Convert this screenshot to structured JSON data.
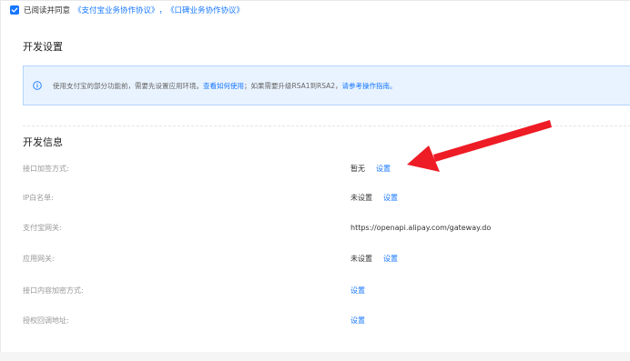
{
  "agreement": {
    "checked": true,
    "text": "已阅读并同意",
    "link_alipay": "《支付宝业务协作协议》",
    "separator": "，",
    "link_koubei": "《口碑业务协作协议》"
  },
  "dev_settings": {
    "title": "开发设置",
    "alert": {
      "text_before": "使用支付宝的部分功能前，需要先设置应用环境。",
      "link_how_to_use": "查看如何使用",
      "text_middle": "；如果需要升级RSA1到RSA2，",
      "link_guide": "请参考操作指南。"
    }
  },
  "dev_info": {
    "title": "开发信息",
    "rows": [
      {
        "label": "接口加签方式:",
        "status": "暂无",
        "action": "设置"
      },
      {
        "label": "IP白名单:",
        "status": "未设置",
        "action": "设置"
      },
      {
        "label": "支付宝网关:",
        "status": "https://openapi.alipay.com/gateway.do",
        "action": ""
      },
      {
        "label": "应用网关:",
        "status": "未设置",
        "action": "设置"
      },
      {
        "label": "接口内容加密方式:",
        "status": "",
        "action": "设置"
      },
      {
        "label": "授权回调地址:",
        "status": "",
        "action": "设置"
      }
    ]
  },
  "colors": {
    "accent": "#1677ff",
    "annotation_arrow": "#ee1c25"
  },
  "icons": {
    "checkbox": "check-icon",
    "alert": "info-circle-icon",
    "annotation": "red-arrow-annotation"
  }
}
